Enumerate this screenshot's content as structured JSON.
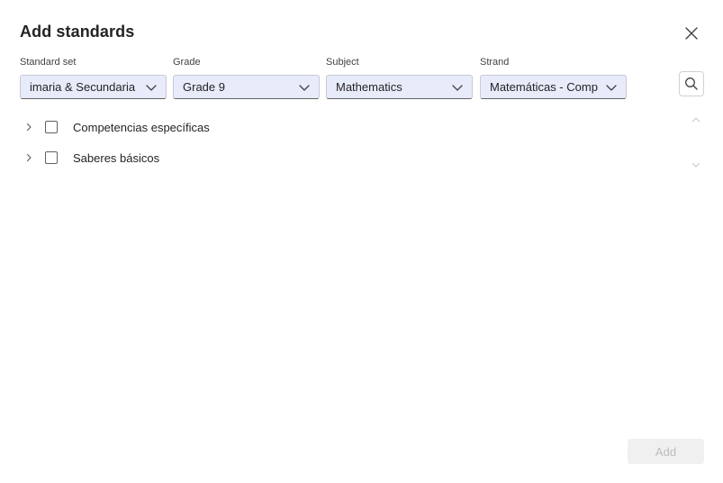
{
  "dialog": {
    "title": "Add standards",
    "close_icon": "close-icon"
  },
  "filters": [
    {
      "label": "Standard set",
      "value": "imaria & Secundaria",
      "icon": "chevron-down-icon"
    },
    {
      "label": "Grade",
      "value": "Grade 9",
      "icon": "chevron-down-icon"
    },
    {
      "label": "Subject",
      "value": "Mathematics",
      "icon": "chevron-down-icon"
    },
    {
      "label": "Strand",
      "value": "Matemáticas - Comp",
      "icon": "chevron-down-icon"
    }
  ],
  "search": {
    "icon": "search-icon"
  },
  "tree": [
    {
      "label": "Competencias específicas",
      "expanded": false,
      "checked": false
    },
    {
      "label": "Saberes básicos",
      "expanded": false,
      "checked": false
    }
  ],
  "scroll": {
    "up_icon": "chevron-up-icon",
    "down_icon": "chevron-down-icon"
  },
  "footer": {
    "add_label": "Add",
    "add_enabled": false
  },
  "colors": {
    "select_bg": "#e8ebfa",
    "text": "#242424",
    "disabled_bg": "#f0f0f0",
    "disabled_text": "#bdbdbd"
  }
}
